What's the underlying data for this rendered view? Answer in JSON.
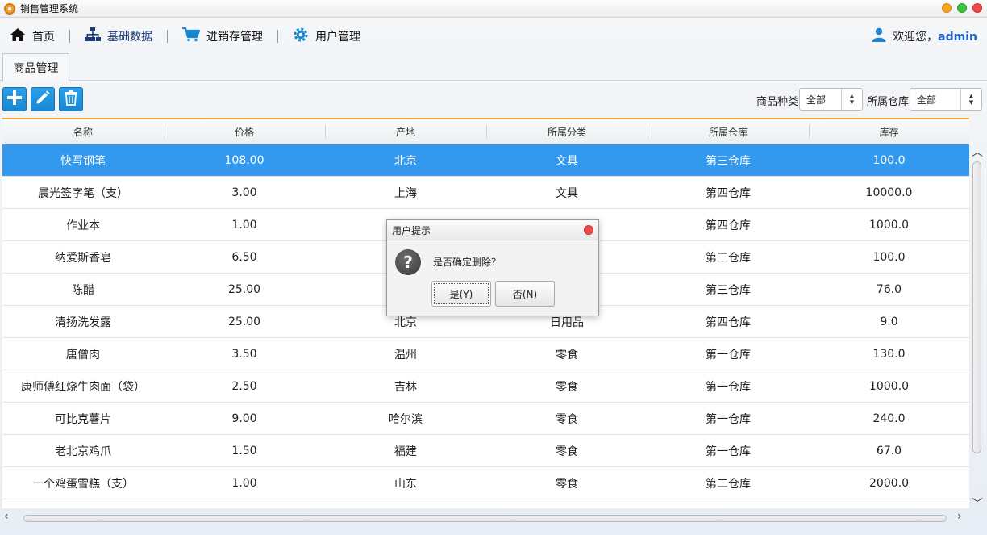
{
  "app": {
    "title": "销售管理系统"
  },
  "nav": {
    "items": [
      {
        "label": "首页",
        "icon": "home-icon"
      },
      {
        "label": "基础数据",
        "icon": "sitemap-icon"
      },
      {
        "label": "进销存管理",
        "icon": "cart-icon"
      },
      {
        "label": "用户管理",
        "icon": "gear-icon"
      }
    ],
    "welcome": "欢迎您，",
    "user": "admin"
  },
  "tab": {
    "label": "商品管理"
  },
  "filters": {
    "category_label": "商品种类",
    "category_value": "全部",
    "warehouse_label": "所属仓库",
    "warehouse_value": "全部"
  },
  "table": {
    "columns": [
      "名称",
      "价格",
      "产地",
      "所属分类",
      "所属仓库",
      "库存"
    ],
    "rows": [
      [
        "快写钢笔",
        "108.00",
        "北京",
        "文具",
        "第三仓库",
        "100.0"
      ],
      [
        "晨光签字笔（支）",
        "3.00",
        "上海",
        "文具",
        "第四仓库",
        "10000.0"
      ],
      [
        "作业本",
        "1.00",
        "",
        "",
        "第四仓库",
        "1000.0"
      ],
      [
        "纳爱斯香皂",
        "6.50",
        "",
        "",
        "第三仓库",
        "100.0"
      ],
      [
        "陈醋",
        "25.00",
        "",
        "",
        "第三仓库",
        "76.0"
      ],
      [
        "清扬洗发露",
        "25.00",
        "北京",
        "日用品",
        "第四仓库",
        "9.0"
      ],
      [
        "唐僧肉",
        "3.50",
        "温州",
        "零食",
        "第一仓库",
        "130.0"
      ],
      [
        "康师傅红烧牛肉面（袋）",
        "2.50",
        "吉林",
        "零食",
        "第一仓库",
        "1000.0"
      ],
      [
        "可比克薯片",
        "9.00",
        "哈尔滨",
        "零食",
        "第一仓库",
        "240.0"
      ],
      [
        "老北京鸡爪",
        "1.50",
        "福建",
        "零食",
        "第一仓库",
        "67.0"
      ],
      [
        "一个鸡蛋雪糕（支）",
        "1.00",
        "山东",
        "零食",
        "第二仓库",
        "2000.0"
      ]
    ],
    "selected_row": 0
  },
  "dialog": {
    "title": "用户提示",
    "message": "是否确定删除？",
    "yes": "是(Y)",
    "no": "否(N)"
  },
  "colors": {
    "accent": "#3399ee",
    "header_border": "#f0a830",
    "toolbar_button": "#1a86d0"
  }
}
